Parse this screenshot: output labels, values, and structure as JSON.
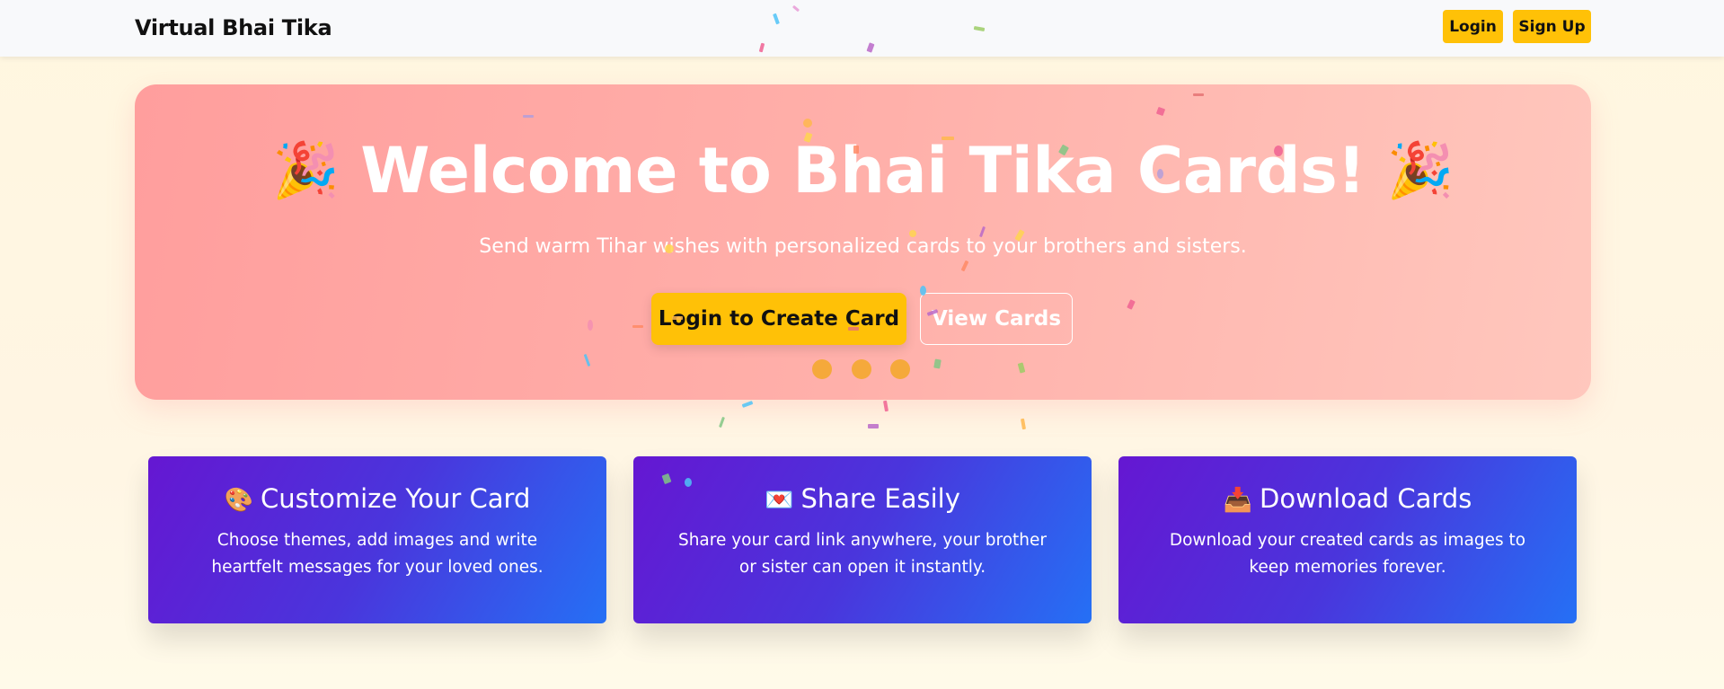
{
  "navbar": {
    "brand": "Virtual Bhai Tika",
    "login_label": "Login",
    "signup_label": "Sign Up"
  },
  "hero": {
    "title": "Welcome to Bhai Tika Cards!",
    "left_emoji": "🎉",
    "right_emoji": "🎉",
    "subtitle": "Send warm Tihar wishes with personalized cards to your brothers and sisters.",
    "primary_button": "Login to Create Card",
    "secondary_button": "View Cards"
  },
  "features": [
    {
      "icon": "🎨",
      "icon_name": "palette-icon",
      "title": "Customize Your Card",
      "text": "Choose themes, add images and write heartfelt messages for your loved ones."
    },
    {
      "icon": "💌",
      "icon_name": "love-letter-icon",
      "title": "Share Easily",
      "text": "Share your card link anywhere, your brother or sister can open it instantly."
    },
    {
      "icon": "📥",
      "icon_name": "inbox-tray-icon",
      "title": "Download Cards",
      "text": "Download your created cards as images to keep memories forever."
    }
  ],
  "colors": {
    "accent_yellow": "#ffc107",
    "hero_gradient_start": "#ff9e9d",
    "hero_gradient_end": "#ffc7bd",
    "card_gradient_start": "#6517d2",
    "card_gradient_end": "#2570f5",
    "loading_dot": "#f5a93b"
  }
}
